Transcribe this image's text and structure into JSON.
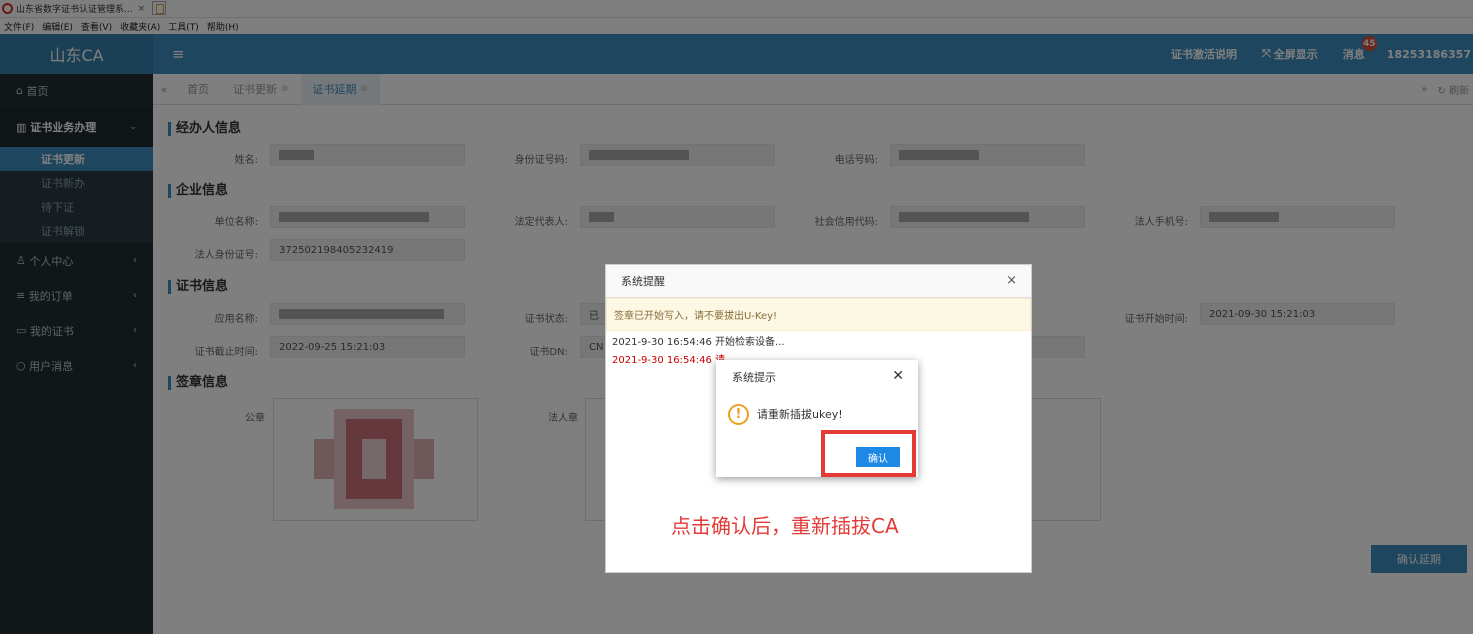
{
  "browser": {
    "tab_title": "山东省数字证书认证管理系...",
    "tab_close": "×"
  },
  "menubar": [
    "文件(F)",
    "编辑(E)",
    "查看(V)",
    "收藏夹(A)",
    "工具(T)",
    "帮助(H)"
  ],
  "topnav": {
    "logo": "山东CA",
    "menu_toggle": "≡",
    "activation_help": "证书激活说明",
    "fullscreen": "全屏显示",
    "messages": "消息",
    "messages_badge": "45",
    "username": "18253186357"
  },
  "sidebar": {
    "home": "首页",
    "business_group": "证书业务办理",
    "business_items": [
      "证书更新",
      "证书新办",
      "待下证",
      "证书解锁"
    ],
    "active_item": "证书更新",
    "personal": "个人中心",
    "orders": "我的订单",
    "certs": "我的证书",
    "messages": "用户消息"
  },
  "tabstrip": {
    "home": "首页",
    "tabs": [
      "证书更新",
      "证书延期"
    ],
    "active_tab": "证书延期",
    "refresh": "刷新"
  },
  "form": {
    "operator_section": "经办人信息",
    "name_label": "姓名:",
    "id_label": "身份证号码:",
    "phone_label": "电话号码:",
    "company_section": "企业信息",
    "unit_label": "单位名称:",
    "legal_rep_label": "法定代表人:",
    "credit_code_label": "社会信用代码:",
    "legal_phone_label": "法人手机号:",
    "legal_id_label": "法人身份证号:",
    "legal_id_value": "372502198405232419",
    "cert_section": "证书信息",
    "app_name_label": "应用名称:",
    "cert_status_label": "证书状态:",
    "cert_status_value": "已",
    "cert_start_label": "证书开始时间:",
    "cert_start_value": "2021-09-30 15:21:03",
    "cert_end_label": "证书截止时间:",
    "cert_end_value": "2022-09-25 15:21:03",
    "cert_dn_label": "证书DN:",
    "cert_dn_value": "CN",
    "seal_section": "签章信息",
    "public_seal_label": "公章",
    "legal_seal_label": "法人章",
    "confirm_extend": "确认延期"
  },
  "modal": {
    "title": "系统提醒",
    "close": "×",
    "alert": "签章已开始写入，请不要拔出U-Key!",
    "log1": "2021-9-30 16:54:46  开始检索设备...",
    "log2": "2021-9-30 16:54:46  请",
    "note": "点击确认后，重新插拔CA"
  },
  "dialog": {
    "title": "系统提示",
    "close": "✕",
    "warn_symbol": "!",
    "message": "请重新插拔ukey!",
    "ok": "确认"
  },
  "colors": {
    "primary": "#3c8dbc",
    "sidebar": "#222d32",
    "highlight": "#e53935"
  }
}
